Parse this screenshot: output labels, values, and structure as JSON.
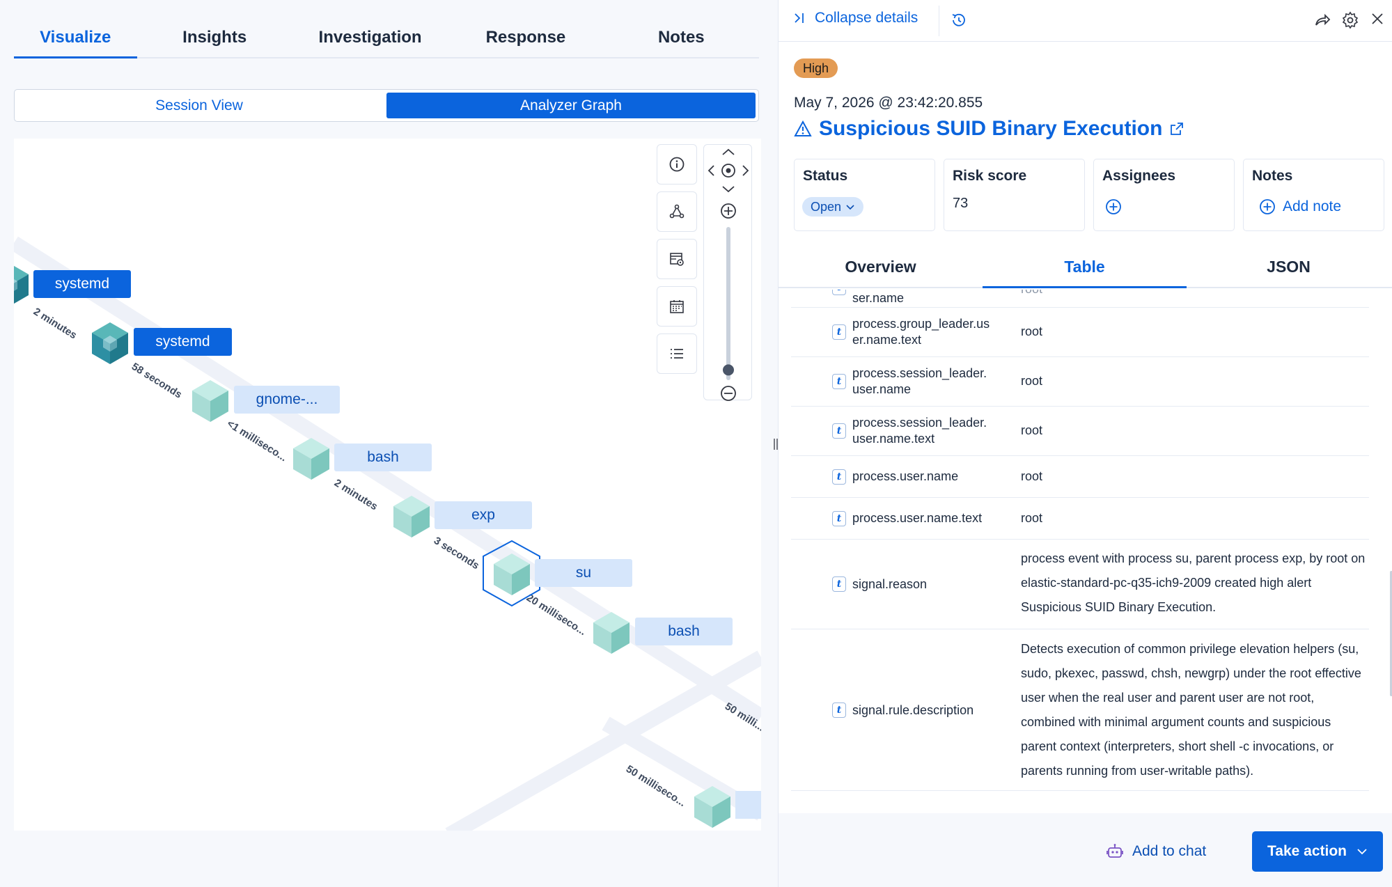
{
  "main_tabs": [
    "Visualize",
    "Insights",
    "Investigation",
    "Response",
    "Notes"
  ],
  "view_toggle": {
    "session": "Session View",
    "analyzer": "Analyzer Graph"
  },
  "graph": {
    "nodes": [
      "systemd",
      "systemd",
      "gnome-...",
      "bash",
      "exp",
      "su",
      "bash"
    ],
    "edges": [
      "2 minutes",
      "58 seconds",
      "<1 milliseco...",
      "2 minutes",
      "3 seconds",
      "20 milliseco...",
      "50 milli...",
      "50 milliseco..."
    ],
    "zoom_level": 0.05
  },
  "details": {
    "collapse_label": "Collapse details",
    "severity": "High",
    "timestamp": "May 7, 2026 @ 23:42:20.855",
    "title": "Suspicious SUID Binary Execution",
    "status_label": "Status",
    "status_value": "Open",
    "risk_label": "Risk score",
    "risk_value": "73",
    "assignees_label": "Assignees",
    "notes_label": "Notes",
    "add_note": "Add note",
    "tabs": [
      "Overview",
      "Table",
      "JSON"
    ]
  },
  "table": {
    "rows": [
      {
        "field": "ser.name",
        "value": "root"
      },
      {
        "field": "process.group_leader.user.name.text",
        "value": "root"
      },
      {
        "field": "process.session_leader.user.name",
        "value": "root"
      },
      {
        "field": "process.session_leader.user.name.text",
        "value": "root"
      },
      {
        "field": "process.user.name",
        "value": "root"
      },
      {
        "field": "process.user.name.text",
        "value": "root"
      },
      {
        "field": "signal.reason",
        "value": "process event with process su, parent process exp, by root on elastic-standard-pc-q35-ich9-2009 created high alert Suspicious SUID Binary Execution."
      },
      {
        "field": "signal.rule.description",
        "value": "Detects execution of common privilege elevation helpers (su, sudo, pkexec, passwd, chsh, newgrp) under the root effective user when the real user and parent user are not root, combined with minimal argument counts and suspicious parent context (interpreters, short shell -c invocations, or parents running from user-writable paths)."
      }
    ]
  },
  "footer": {
    "add_to_chat": "Add to chat",
    "take_action": "Take action"
  },
  "colors": {
    "accent": "#0b64dd",
    "severity_high": "#e39b54",
    "node_light": "#d6e6fb"
  }
}
